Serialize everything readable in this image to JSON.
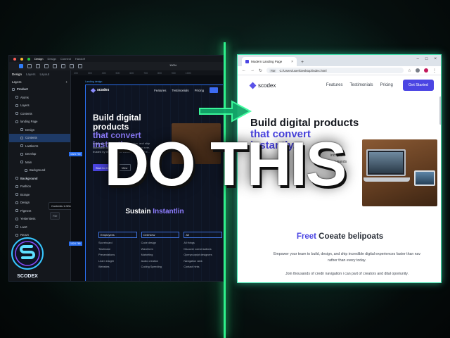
{
  "editor": {
    "menu_tabs": [
      "Design",
      "Design",
      "Connect",
      "Handoff"
    ],
    "zoom": "100%",
    "panel_tabs": [
      "Design",
      "Layers",
      "Layout"
    ],
    "layers_title": "Layers",
    "layers": [
      "Product",
      "Atoms",
      "Layers",
      "Contents",
      "landing Page",
      "Design",
      "Contents",
      "Lastlenrrs",
      "Develop",
      "Main",
      "Background",
      "Background",
      "Fashion",
      "Bcrape",
      "Design",
      "Pigment",
      "Yesterstess",
      "Lanrt",
      "Reavn"
    ],
    "tooltip": "Contents  1.0244",
    "tooltip2": "File",
    "ruler": [
      "200",
      "300",
      "400",
      "500",
      "600",
      "700",
      "800",
      "900",
      "1000",
      "1100",
      "1200",
      "1300",
      "1400",
      "1500",
      "1600"
    ],
    "frame_label": "Landing design",
    "badge_left": "1024 700",
    "badge_left2": "1024 765",
    "frame": {
      "logo": "scodex",
      "nav": [
        "Features",
        "Testimonials",
        "Pricing"
      ],
      "headline_a": "Build digital products",
      "headline_b": "that convert instantly.",
      "paragraph": "Empower your team to build, design, and ship incredible digital experiences faster than ever, trusted by thousands of creators making the...",
      "cta": "Start for free",
      "cta2": "View",
      "section_a": "Sustain ",
      "section_b": "Instantlin",
      "table": [
        {
          "head": "Employees",
          "rows": [
            "Scoreboard",
            "Testimoke",
            "Presentations",
            "Learn insight",
            "Websites"
          ]
        },
        {
          "head": "Overview",
          "rows": [
            "Code design",
            "Waveform",
            "Marketing",
            "Audio creation",
            "Coding Speeding"
          ]
        },
        {
          "head": "All",
          "rows": [
            "All things",
            "Discover conversations",
            "Openyourpipt designers",
            "Navigation dark",
            "Contact hints"
          ]
        }
      ]
    }
  },
  "logo_badge": {
    "label": "SCODEX"
  },
  "browser": {
    "tab_title": "Modern Landing Page",
    "url_chip": "File",
    "url": "C:/Users/user/Desktop/index.html",
    "page": {
      "logo": "scodex",
      "nav": [
        "Features",
        "Testimonials",
        "Pricing"
      ],
      "cta": "Get Started",
      "headline_a": "Build digital products",
      "headline_b": "that convert",
      "headline_c": "instantly.",
      "aside_1": "incredible",
      "aside_2": "thousands",
      "sub_a": "Freet",
      "sub_b": " Coeate belipoats",
      "p1": "Empower your team to build, design, and ship incredible digital experiences faster than nav rather than every today.",
      "p2": "Join thousands of credir navigation i can part of creators and dital oporiunity.",
      "help": "?"
    }
  },
  "overlay": {
    "text": "DO THIS"
  },
  "colors": {
    "accent": "#4b45e3",
    "glow": "#2ef08a",
    "canvas_bg": "#0a0d12"
  }
}
